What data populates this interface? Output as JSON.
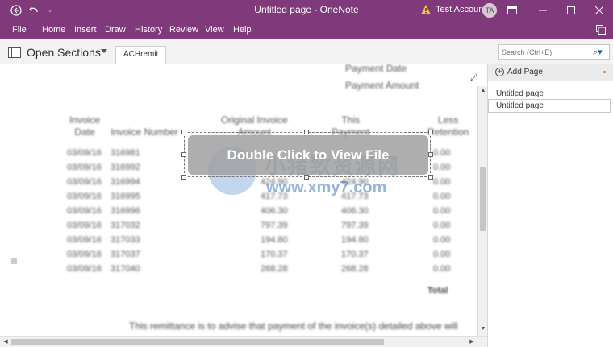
{
  "titlebar": {
    "title": "Untitled page  -  OneNote",
    "account": "Test Account",
    "avatar_initials": "TA",
    "accent_color": "#80397b"
  },
  "menu": {
    "items": [
      "File",
      "Home",
      "Insert",
      "Draw",
      "History",
      "Review",
      "View",
      "Help"
    ]
  },
  "sections": {
    "label": "Open Sections",
    "tab": "ACHremit"
  },
  "search": {
    "placeholder": "Search (Ctrl+E)"
  },
  "document": {
    "payment_date": "Payment Date",
    "payment_amount": "Payment Amount",
    "headers": {
      "invoice_date": [
        "Invoice",
        "Date"
      ],
      "invoice_number": "Invoice Number",
      "original_amount": [
        "Original Invoice",
        "Amount"
      ],
      "this_payment": [
        "This",
        "Payment"
      ],
      "less_retention": [
        "Less",
        "Retention"
      ]
    },
    "rows": [
      {
        "date": "03/09/16",
        "num": "316981",
        "orig": "",
        "pay": "",
        "ret": "0.00"
      },
      {
        "date": "03/09/16",
        "num": "316992",
        "orig": "",
        "pay": "",
        "ret": "0.00"
      },
      {
        "date": "03/09/16",
        "num": "316994",
        "orig": "424.90",
        "pay": "424.90",
        "ret": "0.00"
      },
      {
        "date": "03/09/16",
        "num": "316995",
        "orig": "417.73",
        "pay": "417.73",
        "ret": "0.00"
      },
      {
        "date": "03/09/16",
        "num": "316996",
        "orig": "406.30",
        "pay": "406.30",
        "ret": "0.00"
      },
      {
        "date": "03/09/16",
        "num": "317032",
        "orig": "797.39",
        "pay": "797.39",
        "ret": "0.00"
      },
      {
        "date": "03/09/16",
        "num": "317033",
        "orig": "194.80",
        "pay": "194.80",
        "ret": "0.00"
      },
      {
        "date": "03/09/16",
        "num": "317037",
        "orig": "170.37",
        "pay": "170.37",
        "ret": "0.00"
      },
      {
        "date": "03/09/16",
        "num": "317040",
        "orig": "268.28",
        "pay": "268.28",
        "ret": "0.00"
      }
    ],
    "total_label": "Total",
    "remittance_text": "This remittance is to advise that payment of the invoice(s) detailed above will"
  },
  "embed": {
    "button_label": "Double Click to View File"
  },
  "watermark": {
    "cn_text": "小猪致资源网",
    "url": "www.xmy7.com"
  },
  "pages": {
    "add_label": "Add Page",
    "section_title": "Untitled page",
    "page_item": "Untitled page"
  }
}
